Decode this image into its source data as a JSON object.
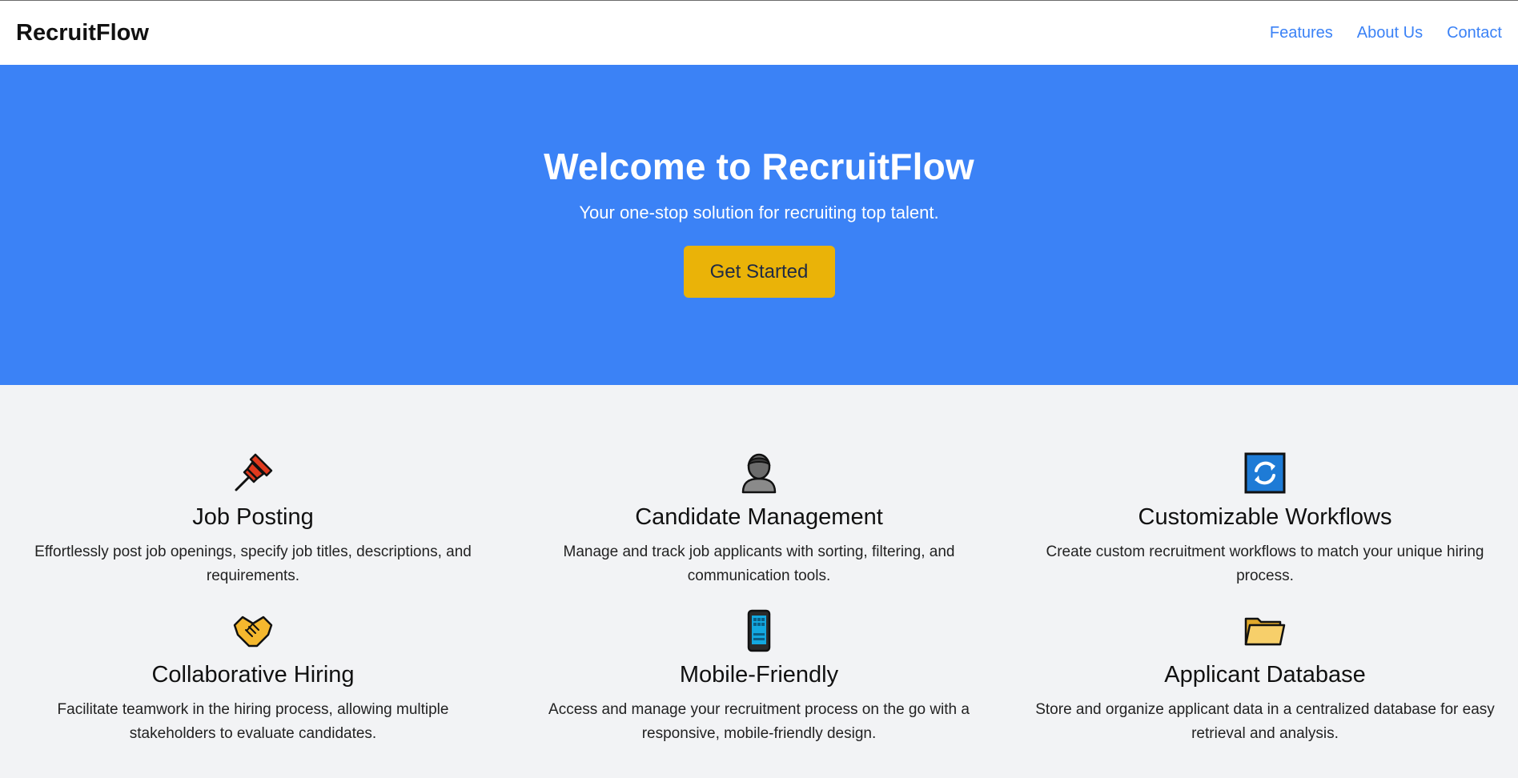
{
  "header": {
    "brand": "RecruitFlow",
    "nav": [
      {
        "label": "Features"
      },
      {
        "label": "About Us"
      },
      {
        "label": "Contact"
      }
    ]
  },
  "hero": {
    "title": "Welcome to RecruitFlow",
    "subtitle": "Your one-stop solution for recruiting top talent.",
    "cta_label": "Get Started"
  },
  "features": [
    {
      "icon": "pushpin-icon",
      "title": "Job Posting",
      "description": "Effortlessly post job openings, specify job titles, descriptions, and requirements."
    },
    {
      "icon": "person-icon",
      "title": "Candidate Management",
      "description": "Manage and track job applicants with sorting, filtering, and communication tools."
    },
    {
      "icon": "refresh-icon",
      "title": "Customizable Workflows",
      "description": "Create custom recruitment workflows to match your unique hiring process."
    },
    {
      "icon": "handshake-icon",
      "title": "Collaborative Hiring",
      "description": "Facilitate teamwork in the hiring process, allowing multiple stakeholders to evaluate candidates."
    },
    {
      "icon": "mobile-phone-icon",
      "title": "Mobile-Friendly",
      "description": "Access and manage your recruitment process on the go with a responsive, mobile-friendly design."
    },
    {
      "icon": "folder-icon",
      "title": "Applicant Database",
      "description": "Store and organize applicant data in a centralized database for easy retrieval and analysis."
    }
  ],
  "colors": {
    "header_bg": "#ffffff",
    "hero_bg": "#3b82f6",
    "cta_bg": "#eab308",
    "nav_link": "#3b82f6",
    "page_bg": "#f2f3f5"
  }
}
